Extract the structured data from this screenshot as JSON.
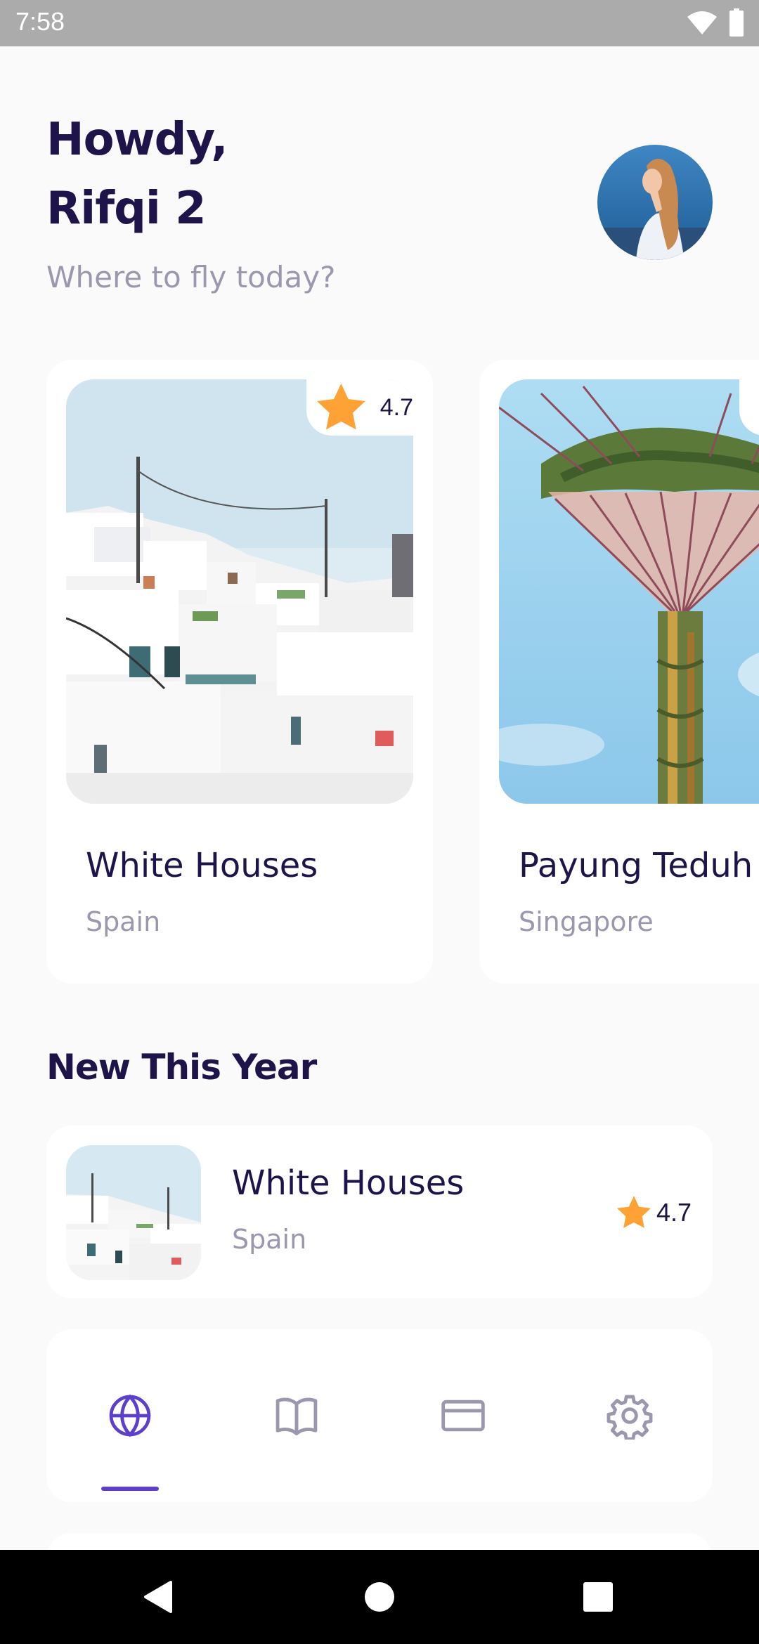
{
  "status_bar": {
    "time": "7:58"
  },
  "header": {
    "greeting_line1": "Howdy,",
    "greeting_line2": "Rifqi 2",
    "subtitle": "Where to fly today?"
  },
  "destinations": [
    {
      "name": "White Houses",
      "country": "Spain",
      "rating": "4.7"
    },
    {
      "name": "Payung Teduh",
      "country": "Singapore",
      "rating": ""
    }
  ],
  "new_this_year": {
    "title": "New This Year",
    "items": [
      {
        "name": "White Houses",
        "country": "Spain",
        "rating": "4.7"
      }
    ]
  },
  "bottom_nav": {
    "items": [
      "globe-icon",
      "book-icon",
      "card-icon",
      "settings-icon"
    ],
    "active": 0,
    "active_color": "#5C40CC",
    "inactive_color": "#9A98AE"
  },
  "colors": {
    "primary_text": "#1F1449",
    "secondary_text": "#9A98AE",
    "star": "#FFA235",
    "accent": "#5C40CC"
  }
}
